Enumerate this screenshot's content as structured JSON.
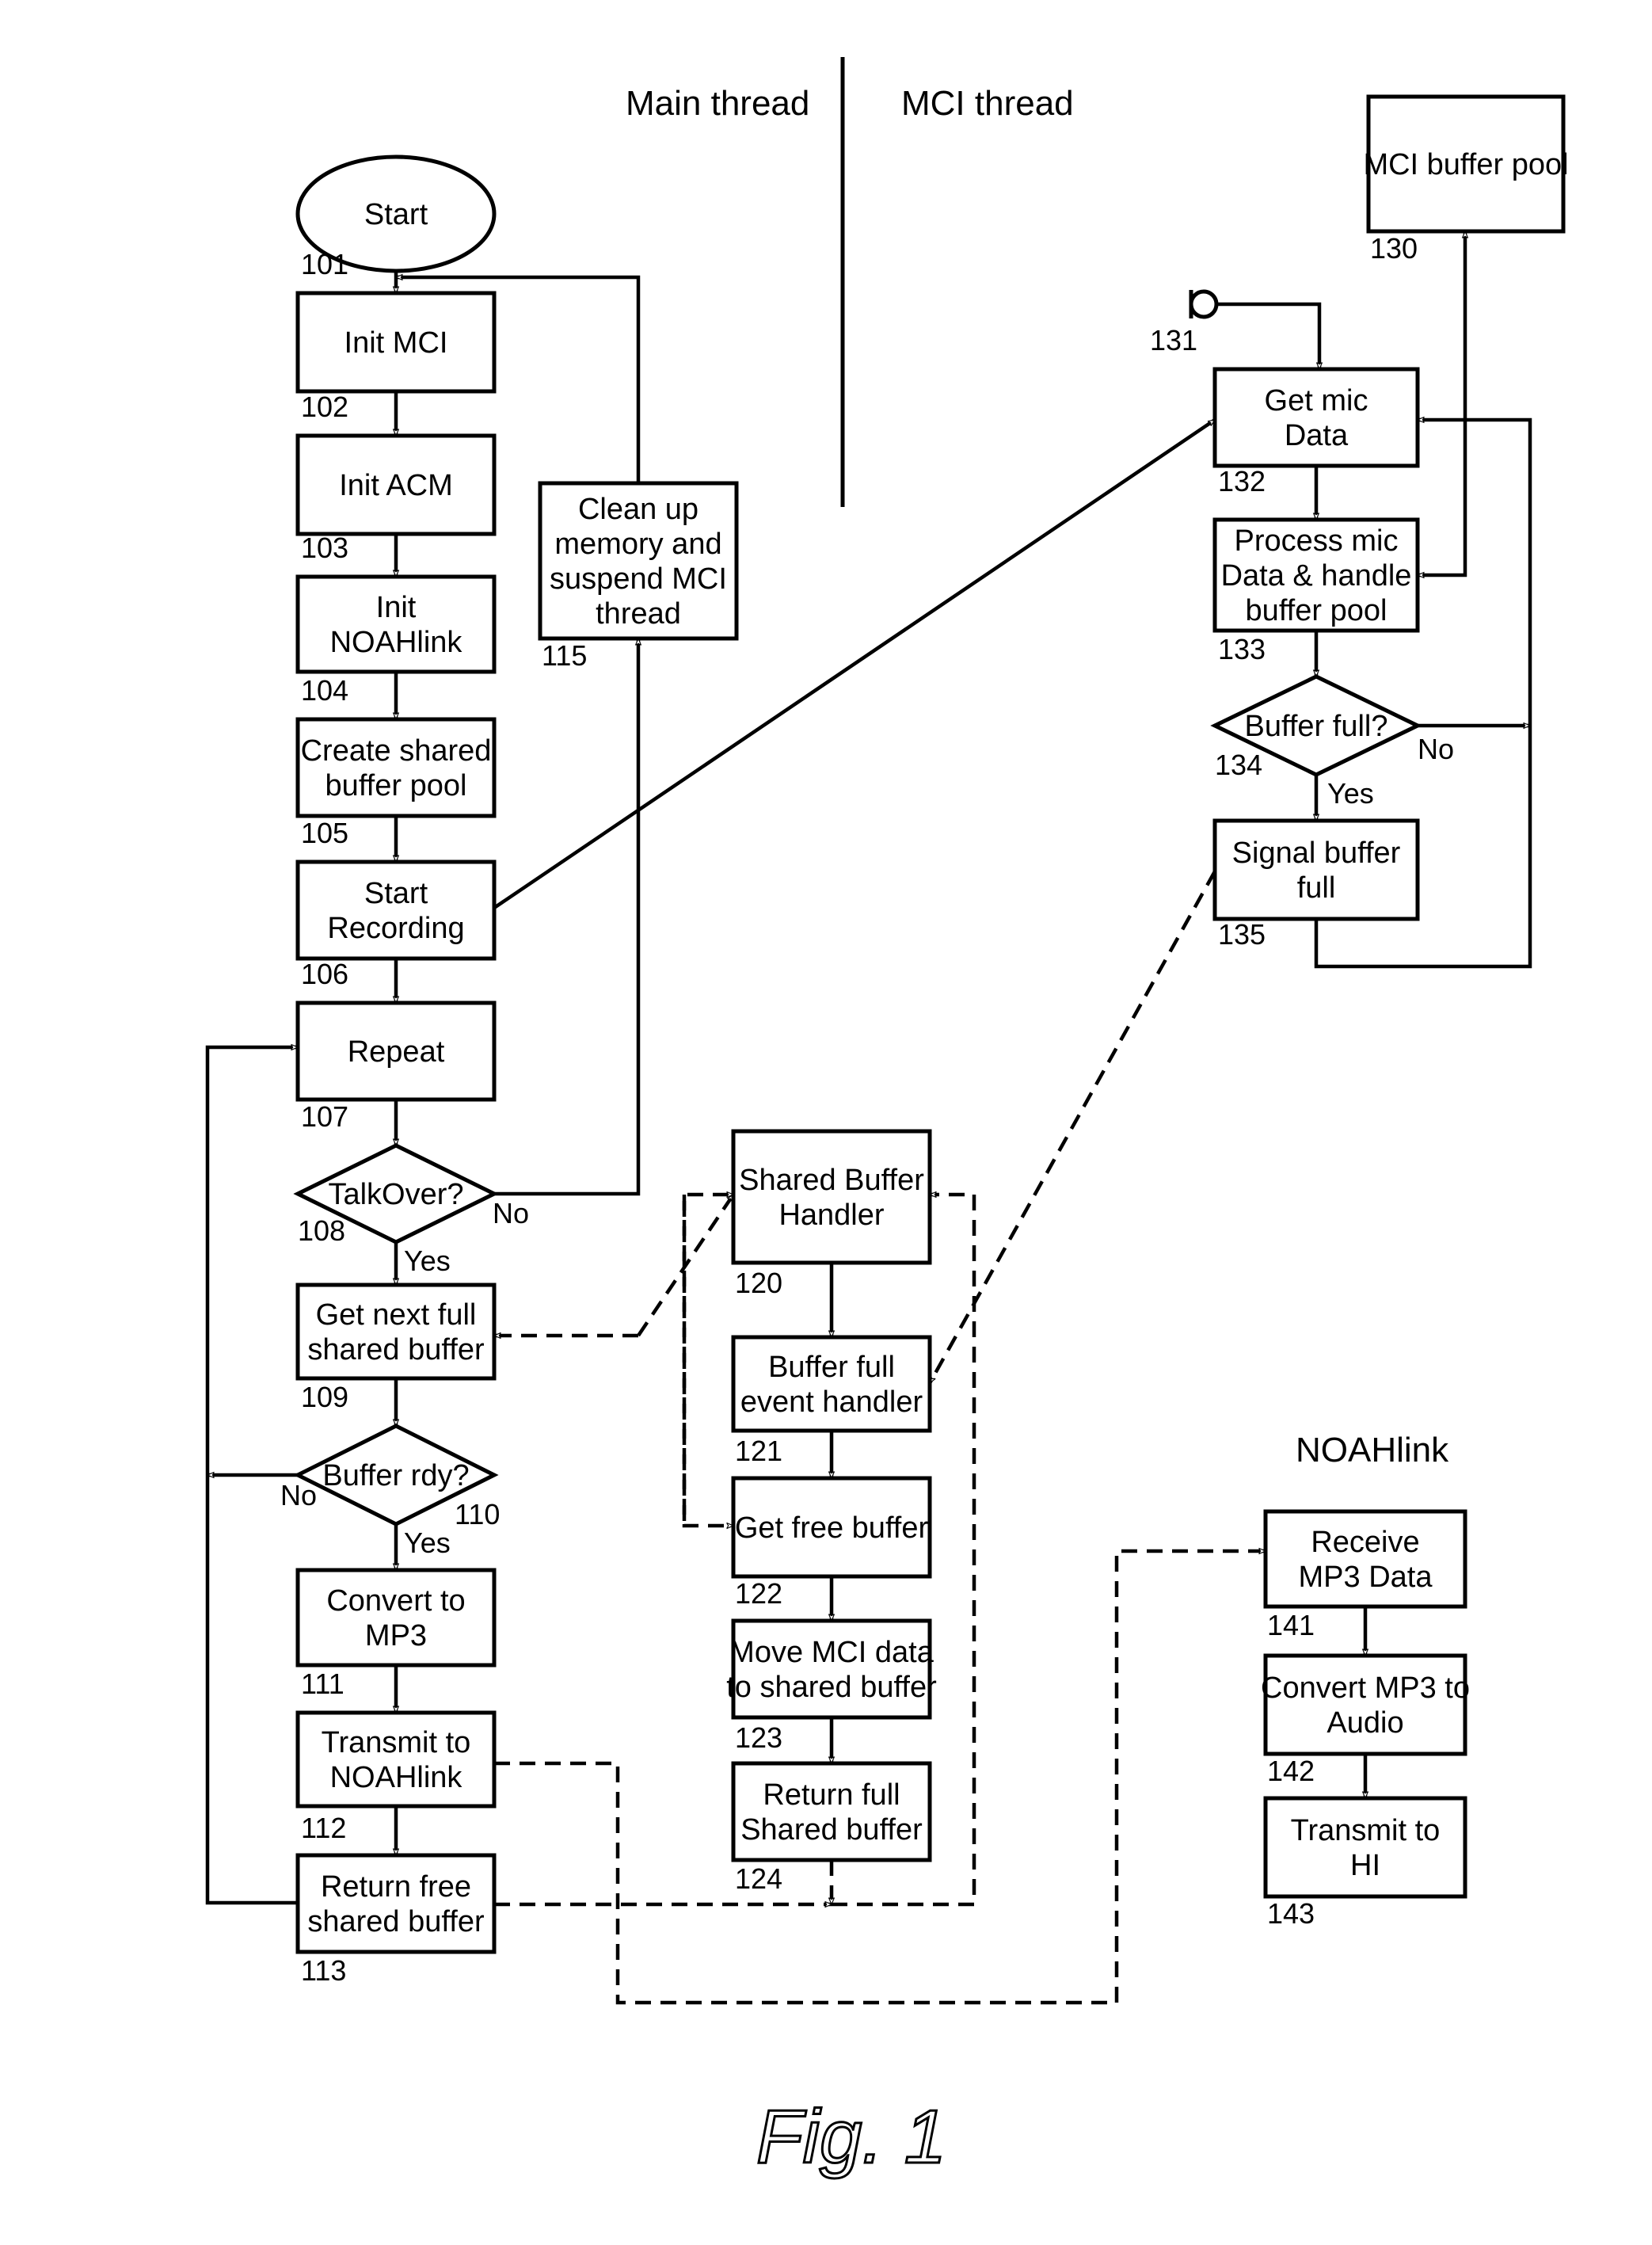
{
  "headings": {
    "main_thread": "Main thread",
    "mci_thread": "MCI thread",
    "noahlink": "NOAHlink"
  },
  "figure_caption": "Fig. 1",
  "nodes": {
    "n101": {
      "ref": "101",
      "lines": [
        "Start"
      ]
    },
    "n102": {
      "ref": "102",
      "lines": [
        "Init MCI"
      ]
    },
    "n103": {
      "ref": "103",
      "lines": [
        "Init ACM"
      ]
    },
    "n104": {
      "ref": "104",
      "lines": [
        "Init",
        "NOAHlink"
      ]
    },
    "n105": {
      "ref": "105",
      "lines": [
        "Create shared",
        "buffer pool"
      ]
    },
    "n106": {
      "ref": "106",
      "lines": [
        "Start",
        "Recording"
      ]
    },
    "n107": {
      "ref": "107",
      "lines": [
        "Repeat"
      ]
    },
    "n108": {
      "ref": "108",
      "lines": [
        "TalkOver?"
      ],
      "yes": "Yes",
      "no": "No"
    },
    "n109": {
      "ref": "109",
      "lines": [
        "Get next full",
        "shared buffer"
      ]
    },
    "n110": {
      "ref": "110",
      "lines": [
        "Buffer rdy?"
      ],
      "yes": "Yes",
      "no": "No"
    },
    "n111": {
      "ref": "111",
      "lines": [
        "Convert to",
        "MP3"
      ]
    },
    "n112": {
      "ref": "112",
      "lines": [
        "Transmit to",
        "NOAHlink"
      ]
    },
    "n113": {
      "ref": "113",
      "lines": [
        "Return free",
        "shared buffer"
      ]
    },
    "n115": {
      "ref": "115",
      "lines": [
        "Clean up",
        "memory and",
        "suspend MCI",
        "thread"
      ]
    },
    "n120": {
      "ref": "120",
      "lines": [
        "Shared Buffer",
        "Handler"
      ]
    },
    "n121": {
      "ref": "121",
      "lines": [
        "Buffer full",
        "event handler"
      ]
    },
    "n122": {
      "ref": "122",
      "lines": [
        "Get free buffer"
      ]
    },
    "n123": {
      "ref": "123",
      "lines": [
        "Move MCI data",
        "to shared buffer"
      ]
    },
    "n124": {
      "ref": "124",
      "lines": [
        "Return full",
        "Shared buffer"
      ]
    },
    "n130": {
      "ref": "130",
      "lines": [
        "MCI buffer pool"
      ]
    },
    "n131": {
      "ref": "131",
      "lines": []
    },
    "n132": {
      "ref": "132",
      "lines": [
        "Get mic",
        "Data"
      ]
    },
    "n133": {
      "ref": "133",
      "lines": [
        "Process mic",
        "Data & handle",
        "buffer pool"
      ]
    },
    "n134": {
      "ref": "134",
      "lines": [
        "Buffer full?"
      ],
      "yes": "Yes",
      "no": "No"
    },
    "n135": {
      "ref": "135",
      "lines": [
        "Signal buffer",
        "full"
      ]
    },
    "n141": {
      "ref": "141",
      "lines": [
        "Receive",
        "MP3 Data"
      ]
    },
    "n142": {
      "ref": "142",
      "lines": [
        "Convert MP3 to",
        "Audio"
      ]
    },
    "n143": {
      "ref": "143",
      "lines": [
        "Transmit to",
        "HI"
      ]
    }
  }
}
